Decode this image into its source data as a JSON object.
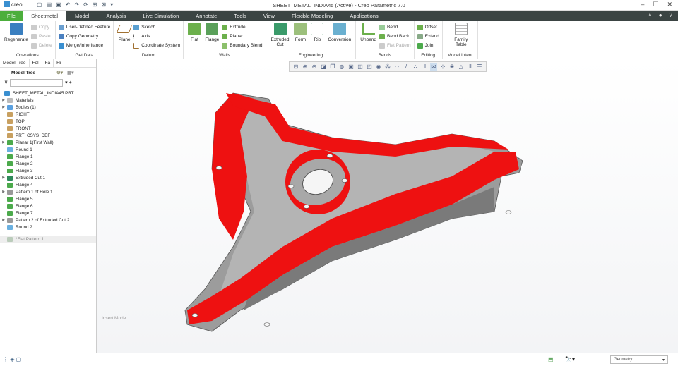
{
  "app": {
    "logo": "creo",
    "window_title": "SHEET_METAL_INDIA45 (Active) - Creo Parametric 7.0"
  },
  "tabs": [
    "File",
    "Sheetmetal",
    "Model",
    "Analysis",
    "Live Simulation",
    "Annotate",
    "Tools",
    "View",
    "Flexible Modeling",
    "Applications"
  ],
  "ribbon": {
    "operations": {
      "label": "Operations",
      "regenerate": "Regenerate",
      "copy": "Copy",
      "paste": "Paste",
      "delete": "Delete"
    },
    "get_data": {
      "label": "Get Data",
      "udf": "User-Defined Feature",
      "copy_geom": "Copy Geometry",
      "merge": "Merge/Inheritance"
    },
    "datum": {
      "label": "Datum",
      "plane": "Plane",
      "sketch": "Sketch",
      "axis": "Axis",
      "csys": "Coordinate System"
    },
    "walls": {
      "label": "Walls",
      "flat": "Flat",
      "flange": "Flange",
      "extrude": "Extrude",
      "planar": "Planar",
      "boundary": "Boundary Blend"
    },
    "engineering": {
      "label": "Engineering",
      "cut": "Extruded Cut",
      "form": "Form",
      "rip": "Rip",
      "conversion": "Conversion"
    },
    "bends": {
      "label": "Bends",
      "unbend": "Unbend",
      "bend": "Bend",
      "bend_back": "Bend Back",
      "flat_pattern": "Flat Pattern"
    },
    "editing": {
      "label": "Editing",
      "offset": "Offset",
      "extend": "Extend",
      "join": "Join"
    },
    "model_intent": {
      "label": "Model Intent",
      "family_table": "Family Table"
    }
  },
  "panel": {
    "tabs": [
      "Model Tree",
      "Fol",
      "Fa",
      "Hi"
    ],
    "title": "Model Tree",
    "search_placeholder": "",
    "tree": [
      {
        "label": "SHEET_METAL_INDIA45.PRT",
        "exp": false,
        "root": true,
        "c": "#3a8fd0"
      },
      {
        "label": "Materials",
        "exp": true,
        "c": "#bbb"
      },
      {
        "label": "Bodies (1)",
        "exp": true,
        "c": "#5aa0e0"
      },
      {
        "label": "RIGHT",
        "exp": false,
        "c": "#c8a060"
      },
      {
        "label": "TOP",
        "exp": false,
        "c": "#c8a060"
      },
      {
        "label": "FRONT",
        "exp": false,
        "c": "#c8a060"
      },
      {
        "label": "PRT_CSYS_DEF",
        "exp": false,
        "c": "#c8a060"
      },
      {
        "label": "Planar 1(First Wall)",
        "exp": true,
        "c": "#4caa4c"
      },
      {
        "label": "Round 1",
        "exp": false,
        "c": "#6ab0e0"
      },
      {
        "label": "Flange 1",
        "exp": false,
        "c": "#4caa4c"
      },
      {
        "label": "Flange 2",
        "exp": false,
        "c": "#4caa4c"
      },
      {
        "label": "Flange 3",
        "exp": false,
        "c": "#4caa4c"
      },
      {
        "label": "Extruded Cut 1",
        "exp": true,
        "c": "#2e8a5a"
      },
      {
        "label": "Flange 4",
        "exp": false,
        "c": "#4caa4c"
      },
      {
        "label": "Pattern 1 of Hole 1",
        "exp": true,
        "c": "#999"
      },
      {
        "label": "Flange 5",
        "exp": false,
        "c": "#4caa4c"
      },
      {
        "label": "Flange 6",
        "exp": false,
        "c": "#4caa4c"
      },
      {
        "label": "Flange 7",
        "exp": false,
        "c": "#4caa4c"
      },
      {
        "label": "Pattern 2 of Extruded Cut 2",
        "exp": true,
        "c": "#999"
      },
      {
        "label": "Round 2",
        "exp": false,
        "c": "#6ab0e0"
      }
    ],
    "suppressed": "*Flat Pattern 1"
  },
  "viewport": {
    "mode": "Insert Mode"
  },
  "status": {
    "filter": "Geometry"
  },
  "colors": {
    "file_tab": "#4cae3c",
    "tab_bar": "#3b4443",
    "model_edge": "#ee1111",
    "model_body": "#9c9c9c"
  }
}
